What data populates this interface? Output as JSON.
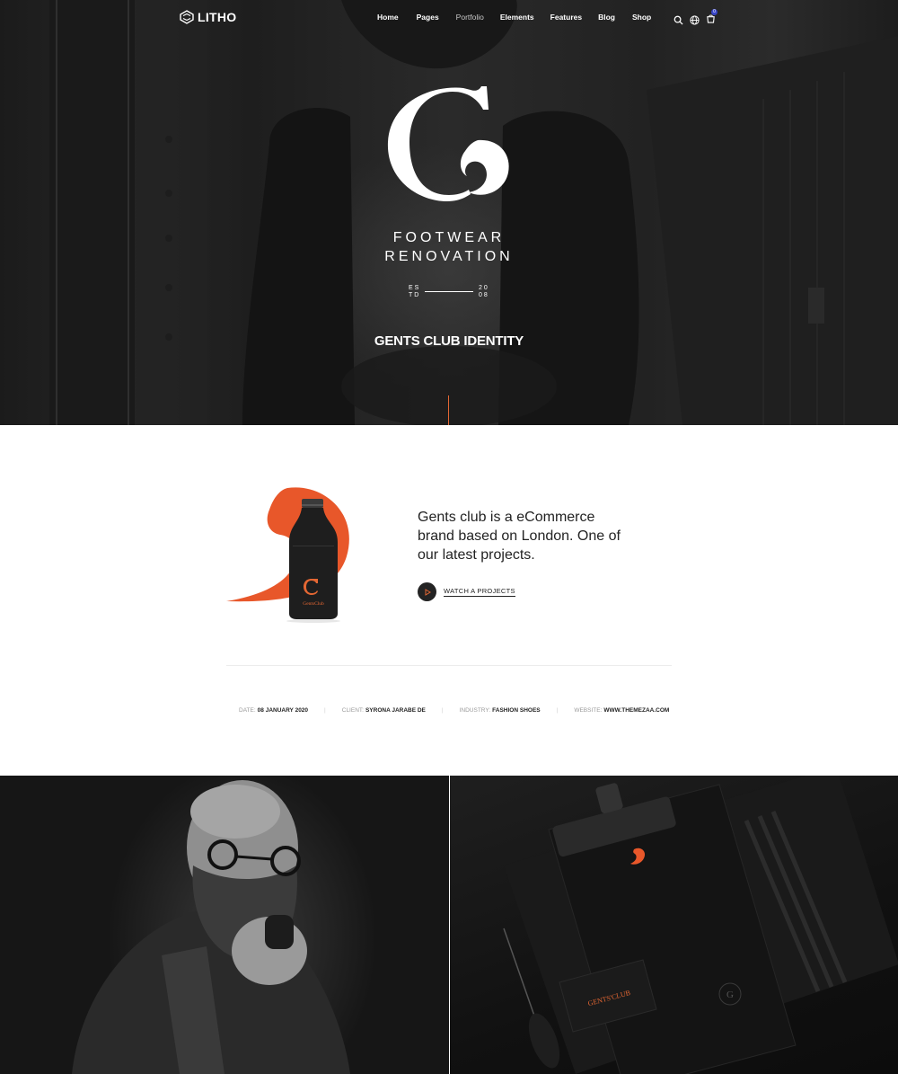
{
  "nav": {
    "logo_text": "LITHO",
    "items": [
      {
        "label": "Home"
      },
      {
        "label": "Pages"
      },
      {
        "label": "Portfolio"
      },
      {
        "label": "Elements"
      },
      {
        "label": "Features"
      },
      {
        "label": "Blog"
      },
      {
        "label": "Shop"
      }
    ],
    "active_item": "Portfolio",
    "icons": [
      "search-icon",
      "globe-icon",
      "cart-icon"
    ],
    "cart_count": "0"
  },
  "hero": {
    "brand_letter": "G",
    "brand_line1": "FOOTWEAR",
    "brand_line2": "RENOVATION",
    "estd_left": "ES TD",
    "estd_right": "20 08",
    "title": "GENTS CLUB IDENTITY",
    "accent_color": "#e46733"
  },
  "intro": {
    "description": "Gents club is a eCommerce brand based on London. One of our latest projects.",
    "watch_label": "WATCH A PROJECTS",
    "product_label": "GentsClub",
    "product_letter": "G",
    "meta": [
      {
        "key": "DATE:",
        "value": "08 JANUARY 2020"
      },
      {
        "key": "CLIENT:",
        "value": "SYRONA JARABE DE"
      },
      {
        "key": "INDUSTRY:",
        "value": "FASHION SHOES"
      },
      {
        "key": "WEBSITE:",
        "value": "WWW.THEMEZAA.COM"
      }
    ]
  },
  "gallery": {
    "card_text": "GENTS'CLUB",
    "card_letter": "G"
  },
  "colors": {
    "accent": "#e46733",
    "dark": "#232323",
    "badge": "#3a47c9"
  }
}
